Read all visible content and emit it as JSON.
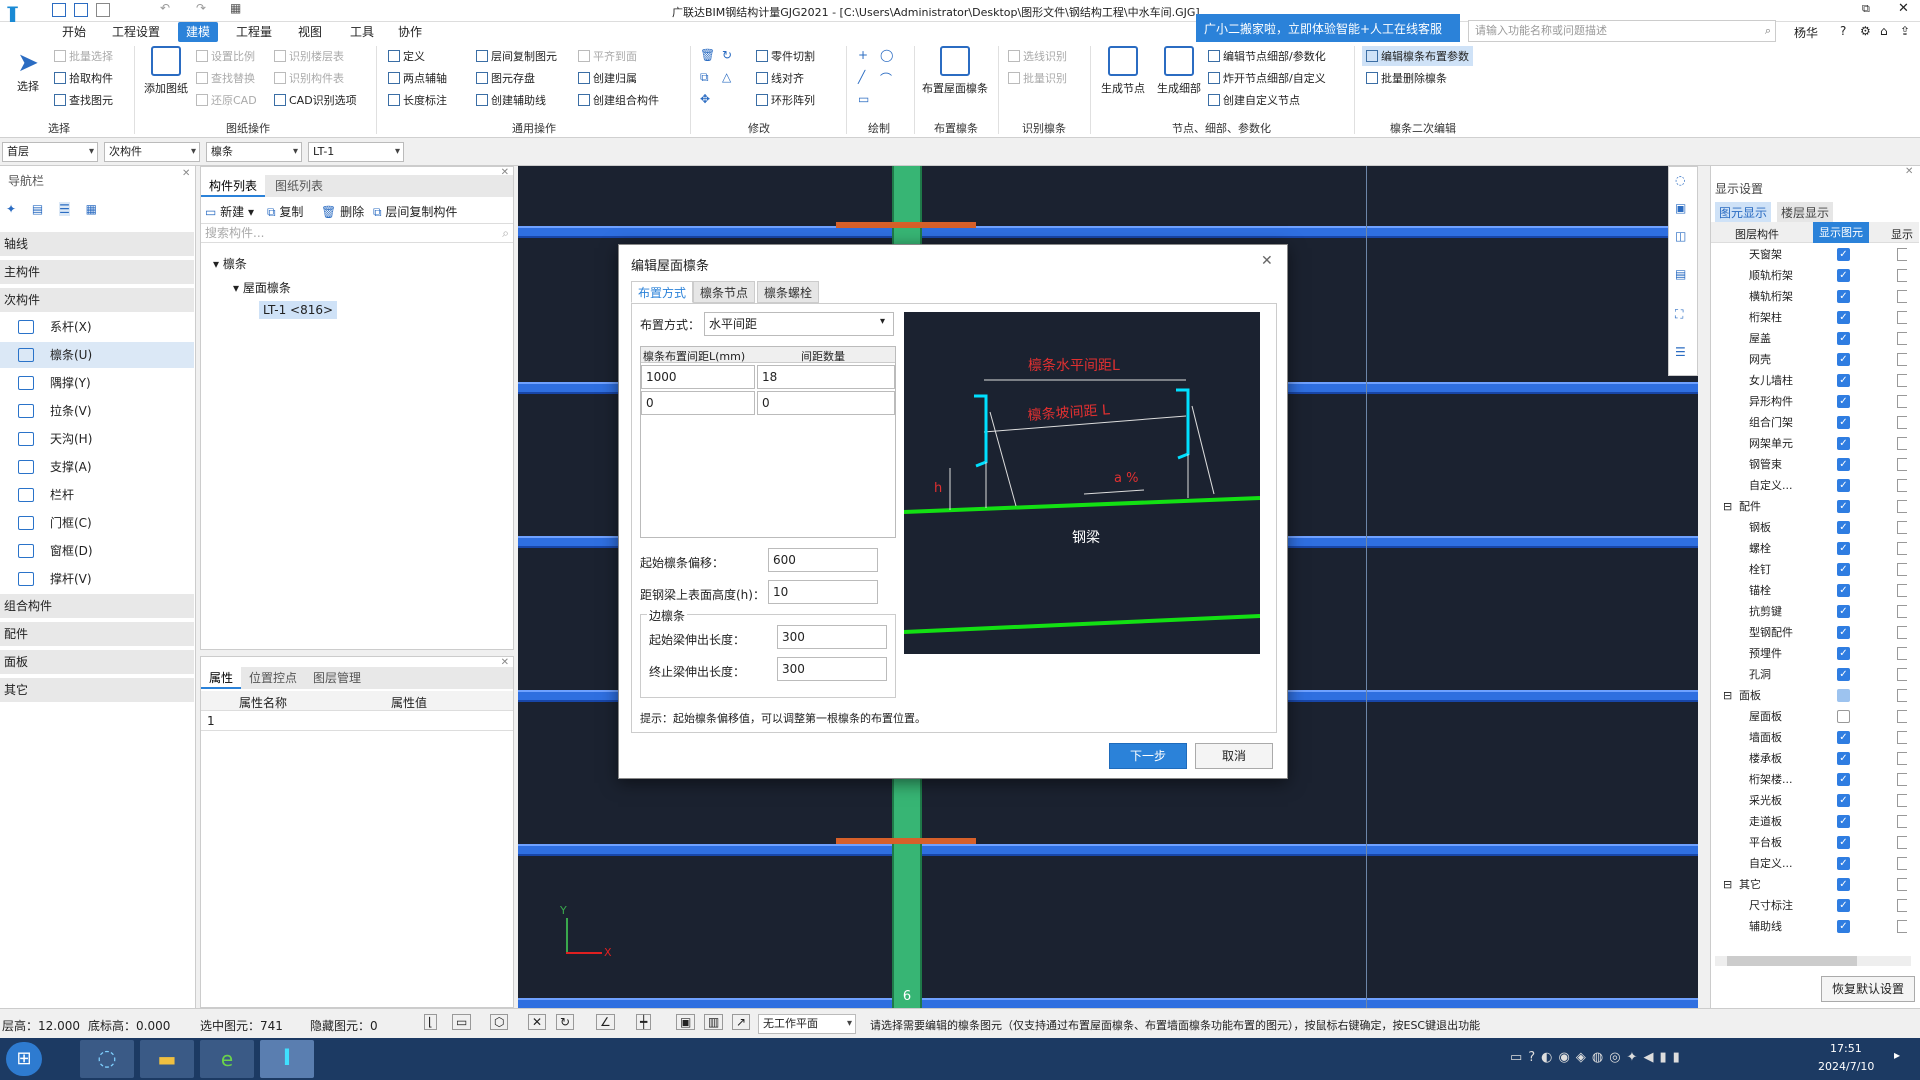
{
  "window": {
    "title": "广联达BIM钢结构计量GJG2021 - [C:\\Users\\Administrator\\Desktop\\图形文件\\钢结构工程\\中水车间.GJG]",
    "user": "杨华",
    "search_placeholder": "请输入功能名称或问题描述",
    "promo": "广小二搬家啦，立即体验智能+人工在线客服"
  },
  "menu": [
    "开始",
    "工程设置",
    "建模",
    "工程量",
    "视图",
    "工具",
    "协作"
  ],
  "ribbon": {
    "select_group": "选择",
    "select_btn": "选择",
    "batch_select": "批量选择",
    "pick_component": "拾取构件",
    "find_element": "查找图元",
    "add_drawing": "添加图纸",
    "set_scale": "设置比例",
    "find_replace": "查找替换",
    "restore_cad": "还原CAD",
    "recognize_floor": "识别楼层表",
    "recognize_component": "识别构件表",
    "cad_options": "CAD识别选项",
    "drawing_ops": "图纸操作",
    "define": "定义",
    "two_point_aux": "两点辅轴",
    "length_dim": "长度标注",
    "floor_copy": "层间复制图元",
    "element_store": "图元存盘",
    "create_aux_line": "创建辅助线",
    "align_top": "平齐到面",
    "create_group": "创建归属",
    "create_combo": "创建组合构件",
    "common_ops": "通用操作",
    "part_cut": "零件切割",
    "line_align": "线对齐",
    "ring_array": "环形阵列",
    "modify": "修改",
    "draw": "绘制",
    "place_roof_purlin": "布置屋面檩条",
    "place_purlin_group": "布置檩条",
    "select_recognize": "选线识别",
    "batch_recognize": "批量识别",
    "recognize_purlin": "识别檩条",
    "gen_node": "生成节点",
    "gen_detail": "生成细部",
    "edit_node_detail": "编辑节点细部/参数化",
    "explode_node": "炸开节点细部/自定义",
    "create_custom_node": "创建自定义节点",
    "node_group": "节点、细部、参数化",
    "edit_purlin_params": "编辑檩条布置参数",
    "batch_delete_purlin": "批量删除檩条",
    "purlin_edit_group": "檩条二次编辑"
  },
  "combos": [
    "首层",
    "次构件",
    "檩条",
    "LT-1"
  ],
  "nav": {
    "title": "导航栏",
    "sections": [
      "轴线",
      "主构件",
      "次构件"
    ],
    "items": [
      "系杆(X)",
      "檩条(U)",
      "隅撑(Y)",
      "拉条(V)",
      "天沟(H)",
      "支撑(A)",
      "栏杆",
      "门框(C)",
      "窗框(D)",
      "撑杆(V)"
    ],
    "more_sections": [
      "组合构件",
      "配件",
      "面板",
      "其它"
    ]
  },
  "component_panel": {
    "tabs": [
      "构件列表",
      "图纸列表"
    ],
    "new": "新建",
    "copy": "复制",
    "delete": "删除",
    "floor_copy": "层间复制构件",
    "search_placeholder": "搜索构件...",
    "tree_root": "檩条",
    "tree_child": "屋面檩条",
    "tree_leaf": "LT-1 <816>"
  },
  "props": {
    "tabs": [
      "属性",
      "位置控点",
      "图层管理"
    ],
    "col_name": "属性名称",
    "col_value": "属性值",
    "row1": "1"
  },
  "dialog": {
    "title": "编辑屋面檩条",
    "tabs": [
      "布置方式",
      "檩条节点",
      "檩条螺栓"
    ],
    "layout_label": "布置方式：",
    "layout_value": "水平间距",
    "col1": "檩条布置间距L(mm)",
    "col2": "间距数量",
    "rows": [
      [
        "1000",
        "18"
      ],
      [
        "0",
        "0"
      ]
    ],
    "start_offset_label": "起始檩条偏移：",
    "start_offset_value": "600",
    "height_label": "距钢梁上表面高度(h)：",
    "height_value": "10",
    "edge_group": "边檩条",
    "start_ext_label": "起始梁伸出长度：",
    "start_ext_value": "300",
    "end_ext_label": "终止梁伸出长度：",
    "end_ext_value": "300",
    "hint": "提示：起始檩条偏移值，可以调整第一根檩条的布置位置。",
    "next": "下一步",
    "cancel": "取消",
    "diagram_h_spacing": "檩条水平间距L",
    "diagram_slope_spacing": "檩条坡间距 L",
    "diagram_angle": "a %",
    "diagram_h": "h",
    "diagram_beam": "钢梁"
  },
  "display": {
    "title": "显示设置",
    "tabs": [
      "图元显示",
      "楼层显示"
    ],
    "col1": "图层构件",
    "col2": "显示图元",
    "col3": "显示",
    "rows": [
      {
        "name": "天窗架",
        "state": "on"
      },
      {
        "name": "顺轨桁架",
        "state": "on"
      },
      {
        "name": "横轨桁架",
        "state": "on"
      },
      {
        "name": "桁架柱",
        "state": "on"
      },
      {
        "name": "屋盖",
        "state": "on"
      },
      {
        "name": "网壳",
        "state": "on"
      },
      {
        "name": "女儿墙柱",
        "state": "on"
      },
      {
        "name": "异形构件",
        "state": "on"
      },
      {
        "name": "组合门架",
        "state": "on"
      },
      {
        "name": "网架单元",
        "state": "on"
      },
      {
        "name": "钢管束",
        "state": "on"
      },
      {
        "name": "自定义...",
        "state": "on"
      },
      {
        "name": "配件",
        "state": "on",
        "group": true
      },
      {
        "name": "钢板",
        "state": "on"
      },
      {
        "name": "螺栓",
        "state": "on"
      },
      {
        "name": "栓钉",
        "state": "on"
      },
      {
        "name": "锚栓",
        "state": "on"
      },
      {
        "name": "抗剪键",
        "state": "on"
      },
      {
        "name": "型钢配件",
        "state": "on"
      },
      {
        "name": "预埋件",
        "state": "on"
      },
      {
        "name": "孔洞",
        "state": "on"
      },
      {
        "name": "面板",
        "state": "part",
        "group": true
      },
      {
        "name": "屋面板",
        "state": "off"
      },
      {
        "name": "墙面板",
        "state": "on"
      },
      {
        "name": "楼承板",
        "state": "on"
      },
      {
        "name": "桁架楼...",
        "state": "on"
      },
      {
        "name": "采光板",
        "state": "on"
      },
      {
        "name": "走道板",
        "state": "on"
      },
      {
        "name": "平台板",
        "state": "on"
      },
      {
        "name": "自定义...",
        "state": "on"
      },
      {
        "name": "其它",
        "state": "on",
        "group": true
      },
      {
        "name": "尺寸标注",
        "state": "on"
      },
      {
        "name": "辅助线",
        "state": "on"
      }
    ],
    "restore": "恢复默认设置"
  },
  "canvas": {
    "axis_label": "6",
    "axis_x": "X",
    "axis_y": "Y"
  },
  "status": {
    "floor_height": "层高：12.000",
    "base_elev": "底标高：0.000",
    "selected": "选中图元：741",
    "hidden": "隐藏图元：0",
    "workplane": "无工作平面",
    "message": "请选择需要编辑的檩条图元（仅支持通过布置屋面檩条、布置墙面檩条功能布置的图元），按鼠标右键确定，按ESC键退出功能"
  },
  "taskbar": {
    "time": "17:51",
    "date": "2024/7/10"
  }
}
